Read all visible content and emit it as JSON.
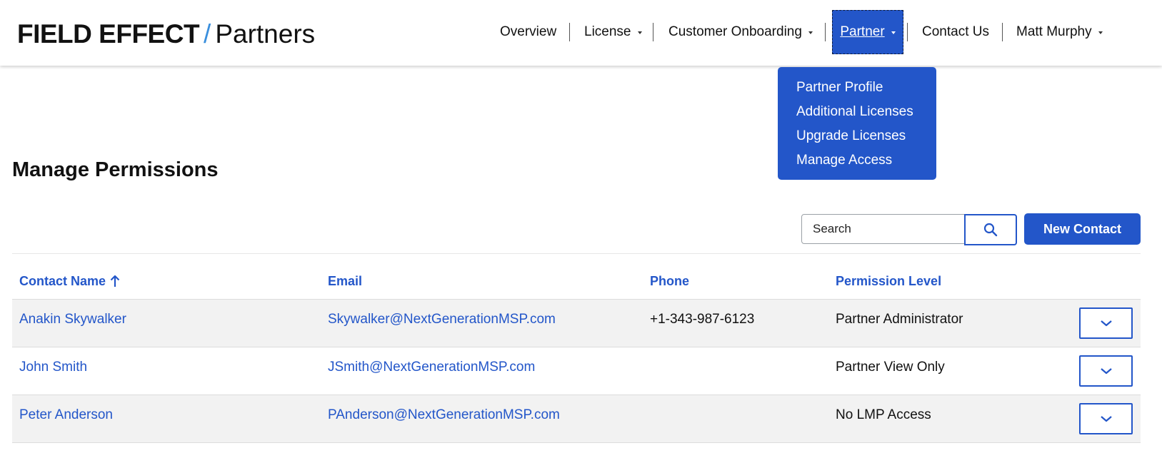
{
  "brand": {
    "name": "FIELD EFFECT",
    "separator": "/",
    "section": "Partners"
  },
  "nav": [
    {
      "label": "Overview",
      "has_caret": false
    },
    {
      "label": "License",
      "has_caret": true
    },
    {
      "label": "Customer Onboarding",
      "has_caret": true
    },
    {
      "label": "Partner",
      "has_caret": true,
      "active": true
    },
    {
      "label": "Contact Us",
      "has_caret": false
    },
    {
      "label": "Matt Murphy",
      "has_caret": true
    }
  ],
  "partner_menu": {
    "items": [
      "Partner Profile",
      "Additional Licenses",
      "Upgrade Licenses",
      "Manage Access"
    ]
  },
  "page": {
    "title": "Manage Permissions",
    "search": {
      "placeholder": "Search",
      "value": ""
    },
    "new_contact_label": "New Contact"
  },
  "table": {
    "columns": [
      "Contact Name",
      "Email",
      "Phone",
      "Permission Level"
    ],
    "sorted_column": "Contact Name",
    "sort_direction": "ascending",
    "rows": [
      {
        "name": "Anakin Skywalker",
        "email": "Skywalker@NextGenerationMSP.com",
        "phone": "+1-343-987-6123",
        "permission": "Partner Administrator"
      },
      {
        "name": "John Smith",
        "email": "JSmith@NextGenerationMSP.com",
        "phone": "",
        "permission": "Partner View Only"
      },
      {
        "name": "Peter Anderson",
        "email": "PAnderson@NextGenerationMSP.com",
        "phone": "",
        "permission": "No LMP Access"
      }
    ]
  },
  "colors": {
    "accent": "#2356c9",
    "brand_slash": "#3a8fdd",
    "row_alt": "#f2f2f2"
  },
  "icons": {
    "search_button": "search-icon",
    "row_toggle": "chevron-down-icon",
    "sort": "arrow-up-icon",
    "nav_caret": "caret-down-icon"
  }
}
